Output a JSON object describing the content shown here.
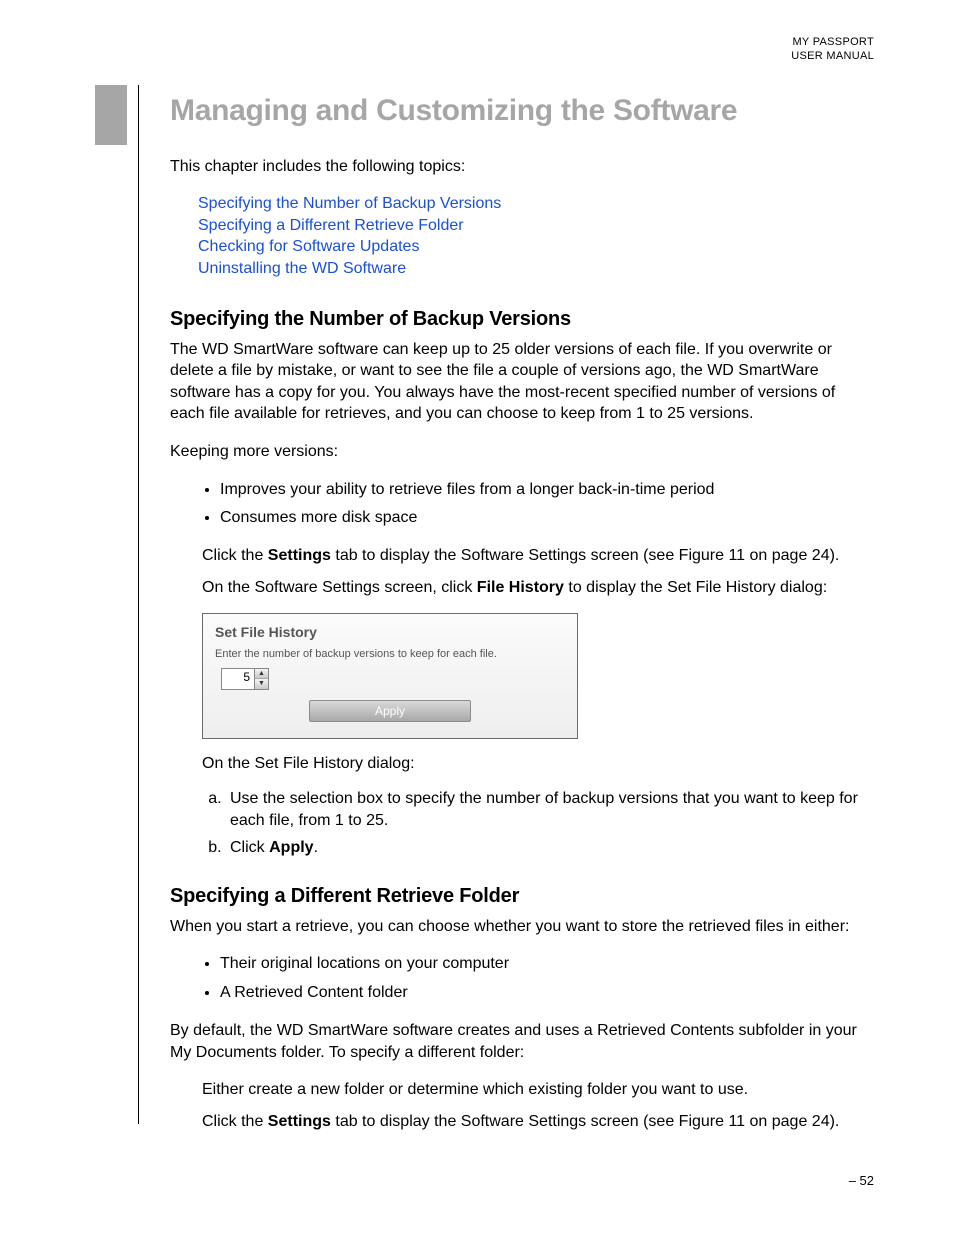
{
  "header": {
    "l1": "MY PASSPORT",
    "l2": "USER MANUAL"
  },
  "title": "Managing and Customizing the Software",
  "intro": "This chapter includes the following topics:",
  "toc": [
    "Specifying the Number of Backup Versions",
    "Specifying a Different Retrieve Folder",
    "Checking for Software Updates",
    "Uninstalling the WD Software"
  ],
  "s1": {
    "heading": "Specifying the Number of Backup Versions",
    "p1": "The WD SmartWare software can keep up to 25 older versions of each file. If you overwrite or delete a file by mistake, or want to see the file a couple of versions ago, the WD SmartWare software has a copy for you. You always have the most-recent specified number of versions of each file available for retrieves, and you can choose to keep from 1 to 25 versions.",
    "p2": "Keeping more versions:",
    "bullets": [
      "Improves your ability to retrieve files from a longer back-in-time period",
      "Consumes more disk space"
    ],
    "step1a": "Click the ",
    "step1b": "Settings",
    "step1c": " tab to display the Software Settings screen (see Figure 11 on page 24).",
    "step2a": "On the Software Settings screen, click ",
    "step2b": "File History",
    "step2c": " to display the Set File History dialog:",
    "dialog": {
      "title": "Set File History",
      "prompt": "Enter the number of backup versions to keep for each file.",
      "value": "5",
      "apply": "Apply"
    },
    "after": "On the Set File History dialog:",
    "letters_a": "Use the selection box to specify the number of backup versions that you want to keep for each file, from 1 to 25.",
    "letters_b1": "Click ",
    "letters_b2": "Apply",
    "letters_b3": "."
  },
  "s2": {
    "heading": "Specifying a Different Retrieve Folder",
    "p1": "When you start a retrieve, you can choose whether you want to store the retrieved files in either:",
    "bullets": [
      "Their original locations on your computer",
      "A Retrieved Content folder"
    ],
    "p2": "By default, the WD SmartWare software creates and uses a Retrieved Contents subfolder in your My Documents folder. To specify a different folder:",
    "step1": "Either create a new folder or determine which existing folder you want to use.",
    "step2a": "Click the ",
    "step2b": "Settings",
    "step2c": " tab to display the Software Settings screen (see Figure 11 on page 24)."
  },
  "pagenum": "– 52"
}
